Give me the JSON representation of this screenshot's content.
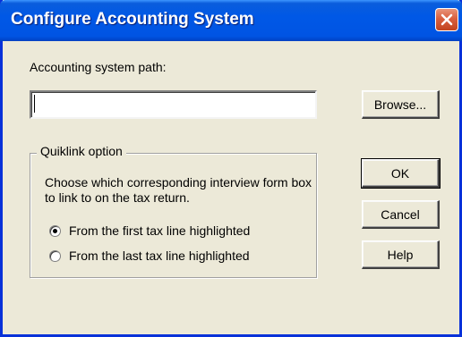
{
  "window": {
    "title": "Configure Accounting System"
  },
  "path": {
    "label": "Accounting system path:",
    "value": "",
    "browse_label": "Browse..."
  },
  "quiklink": {
    "legend": "Quiklink option",
    "description": "Choose which corresponding interview form box to link to on the tax return.",
    "options": [
      {
        "label": "From the first tax line highlighted",
        "selected": true
      },
      {
        "label": "From the last tax line highlighted",
        "selected": false
      }
    ]
  },
  "buttons": {
    "ok_label": "OK",
    "cancel_label": "Cancel",
    "help_label": "Help"
  },
  "icons": {
    "close": "close-icon",
    "radio_checked": "radio-checked",
    "radio_unchecked": "radio-unchecked"
  },
  "colors": {
    "titlebar": "#0054e3",
    "dialog_bg": "#ece9d8",
    "close_button": "#d9603f"
  }
}
